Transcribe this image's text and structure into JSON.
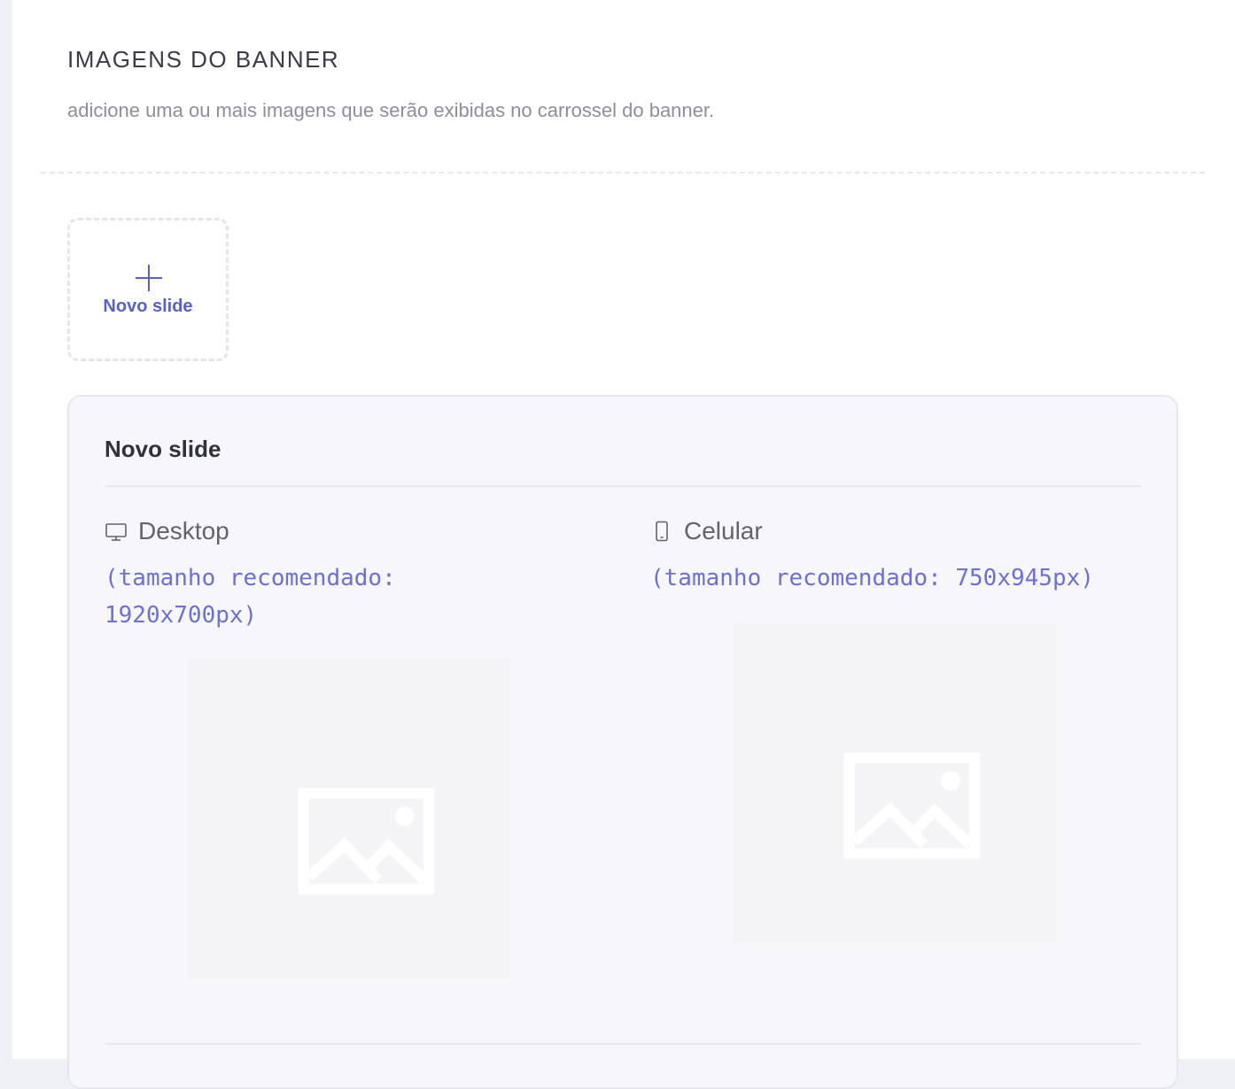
{
  "section": {
    "title": "IMAGENS DO BANNER",
    "subtitle": "adicione uma ou mais imagens que serão exibidas no carrossel do banner."
  },
  "add_slide": {
    "label": "Novo slide",
    "icon": "plus-icon"
  },
  "slide": {
    "title": "Novo slide",
    "desktop": {
      "label": "Desktop",
      "icon": "desktop-icon",
      "hint": "(tamanho recomendado: 1920x700px)",
      "placeholder_icon": "image-placeholder-icon"
    },
    "mobile": {
      "label": "Celular",
      "icon": "mobile-icon",
      "hint": "(tamanho recomendado: 750x945px)",
      "placeholder_icon": "image-placeholder-icon"
    }
  },
  "colors": {
    "accent": "#5a5ed6",
    "hint_text": "#6b6fd8",
    "title_text": "#3a3b4a",
    "muted_text": "#8d8e9d",
    "panel_bg": "#f7f7fb",
    "placeholder_bg": "#f4f4f6"
  }
}
